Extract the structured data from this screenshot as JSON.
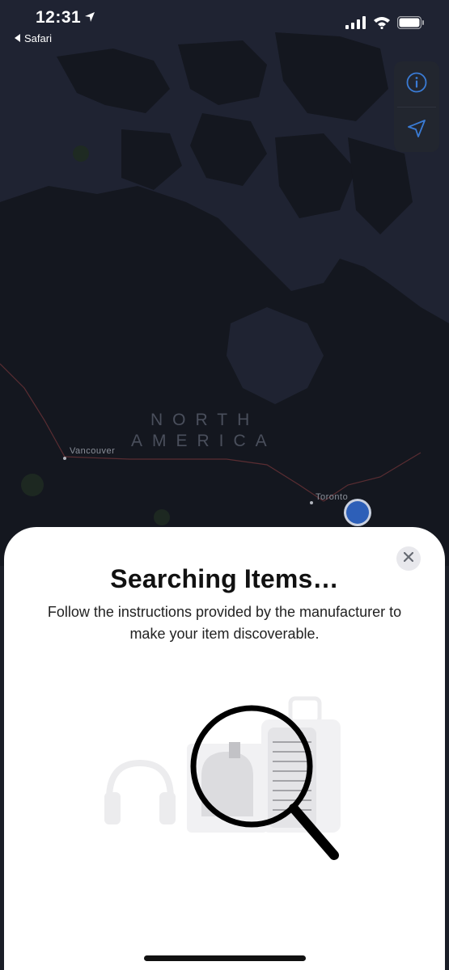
{
  "status_bar": {
    "time": "12:31",
    "back_app": "Safari",
    "icons": [
      "location-arrow-icon",
      "signal-icon",
      "wifi-icon",
      "battery-icon"
    ]
  },
  "map": {
    "region_label_line1": "NORTH",
    "region_label_line2": "AMERICA",
    "cities": [
      "Vancouver",
      "Toronto"
    ]
  },
  "map_controls": {
    "info_icon": "info-icon",
    "locate_icon": "location-arrow-icon",
    "accent_color": "#3a7bd5"
  },
  "sheet": {
    "title": "Searching Items…",
    "subtitle": "Follow the instructions provided by the manufacturer to make your item discoverable.",
    "close_icon": "close-icon",
    "illustration_items": [
      "headphones-icon",
      "backpack-icon",
      "suitcase-icon",
      "magnifier-icon"
    ]
  }
}
